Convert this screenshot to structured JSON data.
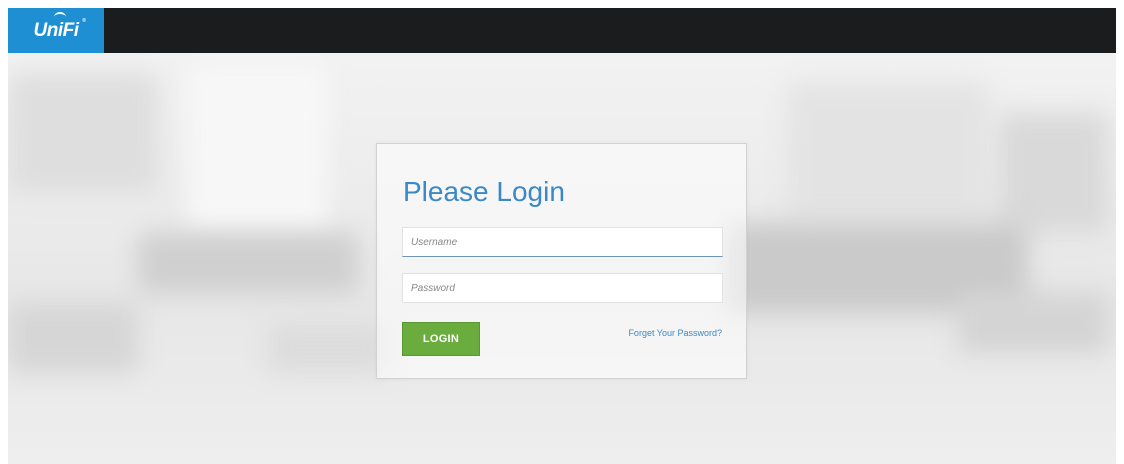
{
  "brand": {
    "logo_text": "UniFi",
    "logo_color": "#1f8fd4",
    "topbar_color": "#1b1c1e"
  },
  "login": {
    "title": "Please Login",
    "username_placeholder": "Username",
    "password_placeholder": "Password",
    "login_button": "LOGIN",
    "forgot_link": "Forget Your Password?",
    "accent_color": "#3a89c6",
    "button_color": "#6aac3e"
  }
}
